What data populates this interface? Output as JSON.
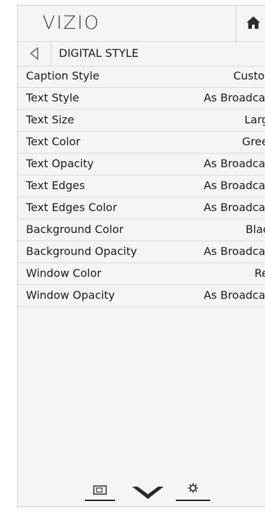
{
  "header": {
    "logo": "VIZIO",
    "home_icon": "home-icon"
  },
  "nav": {
    "back_icon": "chevron-left-icon",
    "title": "DIGITAL STYLE"
  },
  "menu": [
    {
      "label": "Caption Style",
      "value": "Custom"
    },
    {
      "label": "Text Style",
      "value": "As Broadcast"
    },
    {
      "label": "Text Size",
      "value": "Large"
    },
    {
      "label": "Text Color",
      "value": "Green"
    },
    {
      "label": "Text Opacity",
      "value": "As Broadcast"
    },
    {
      "label": "Text Edges",
      "value": "As Broadcast"
    },
    {
      "label": "Text Edges Color",
      "value": "As Broadcast"
    },
    {
      "label": "Background Color",
      "value": "Black"
    },
    {
      "label": "Background Opacity",
      "value": "As Broadcast"
    },
    {
      "label": "Window Color",
      "value": "Red"
    },
    {
      "label": "Window Opacity",
      "value": "As Broadcast"
    }
  ],
  "bottom_bar": {
    "icons": [
      "input-icon",
      "vizio-v-icon",
      "settings-gear-icon"
    ]
  }
}
